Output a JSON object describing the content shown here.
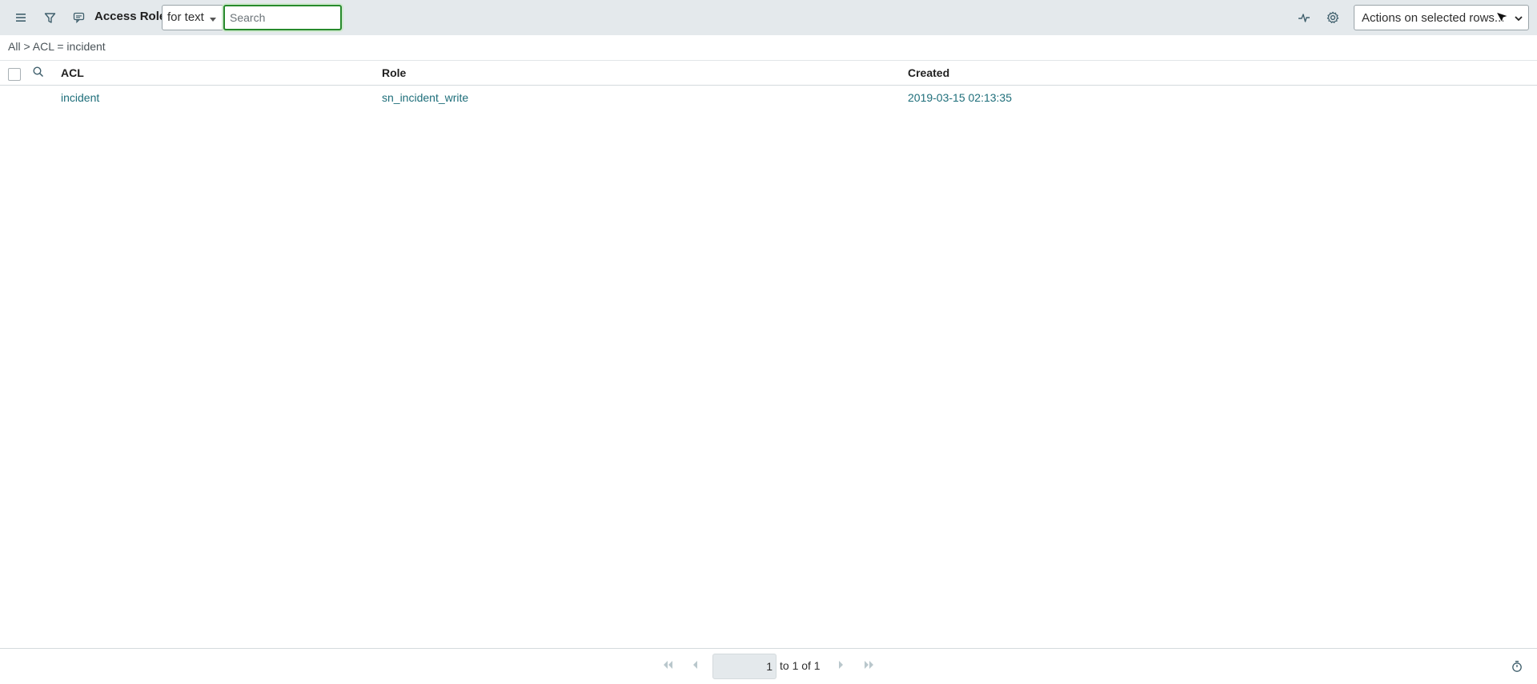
{
  "header": {
    "title": "Access Roles",
    "search_field_select": "for text",
    "search_placeholder": "Search",
    "actions_select": "Actions on selected rows...",
    "icons": [
      "hamburger-menu-icon",
      "filter-icon",
      "comment-icon",
      "activity-pulse-icon",
      "gear-icon",
      "chevron-down-icon"
    ]
  },
  "breadcrumb": {
    "all": "All",
    "separator": ">",
    "condition": "ACL = incident"
  },
  "table": {
    "columns": [
      "ACL",
      "Role",
      "Created"
    ],
    "rows": [
      {
        "acl": "incident",
        "role": "sn_incident_write",
        "created": "2019-03-15 02:13:35"
      }
    ]
  },
  "pagination": {
    "current_page": "1",
    "range_text": "to 1 of 1"
  },
  "colors": {
    "header_bg": "#e4e9ec",
    "link": "#1e6e7a",
    "search_focus": "#278a2c"
  }
}
